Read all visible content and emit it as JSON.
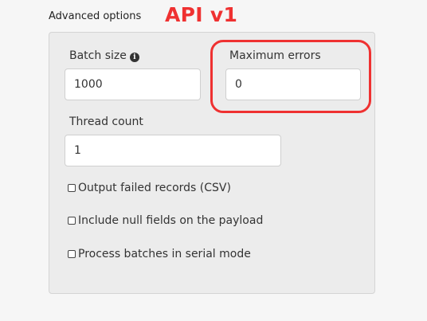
{
  "section": {
    "title": "Advanced options"
  },
  "annotation": {
    "label": "API v1",
    "color": "#ef3131"
  },
  "fields": {
    "batch_size": {
      "label": "Batch size",
      "icon": "info-icon",
      "value": "1000"
    },
    "maximum_errors": {
      "label": "Maximum errors",
      "value": "0"
    },
    "thread_count": {
      "label": "Thread count",
      "value": "1"
    }
  },
  "checkboxes": [
    {
      "label": "Output failed records (CSV)",
      "checked": false
    },
    {
      "label": "Include null fields on the payload",
      "checked": false
    },
    {
      "label": "Process batches in serial mode",
      "checked": false
    }
  ]
}
